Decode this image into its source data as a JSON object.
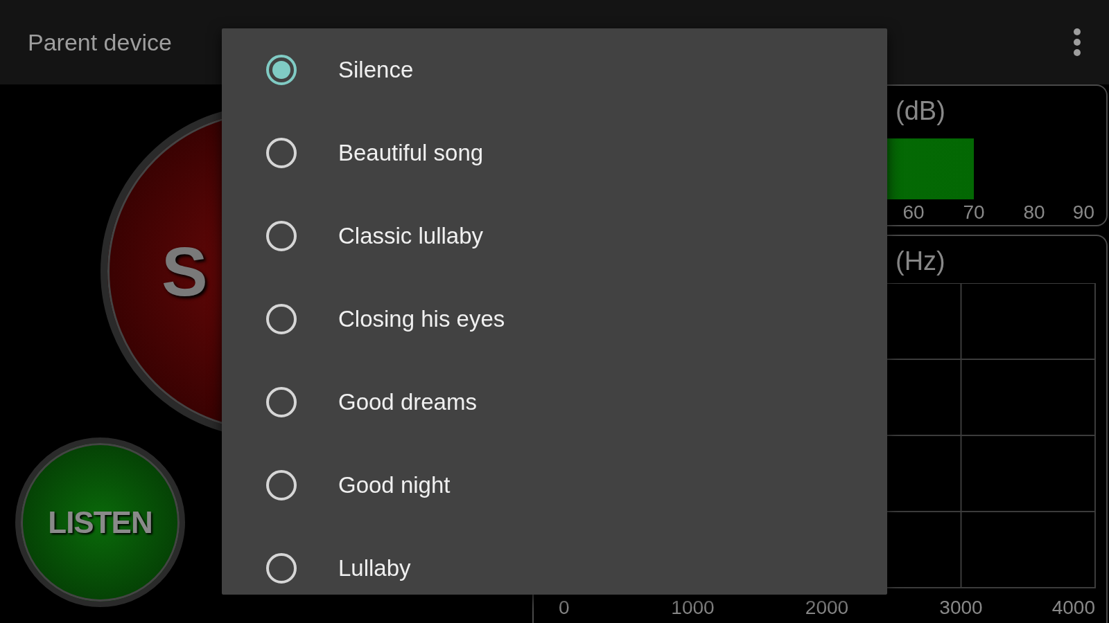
{
  "top_bar": {
    "title": "Parent device"
  },
  "stop_button": {
    "label": "S"
  },
  "listen_button": {
    "label": "LISTEN"
  },
  "volume_panel": {
    "title": "(dB)",
    "meter": {
      "level": 0.778
    },
    "ticks": [
      "60",
      "70",
      "80",
      "90"
    ]
  },
  "spectrum_panel": {
    "title": "(Hz)",
    "x_ticks": [
      "0",
      "1000",
      "2000",
      "3000",
      "4000"
    ]
  },
  "dialog": {
    "options": [
      {
        "label": "Silence",
        "selected": true
      },
      {
        "label": "Beautiful song",
        "selected": false
      },
      {
        "label": "Classic lullaby",
        "selected": false
      },
      {
        "label": "Closing his eyes",
        "selected": false
      },
      {
        "label": "Good dreams",
        "selected": false
      },
      {
        "label": "Good night",
        "selected": false
      },
      {
        "label": "Lullaby",
        "selected": false
      }
    ]
  }
}
